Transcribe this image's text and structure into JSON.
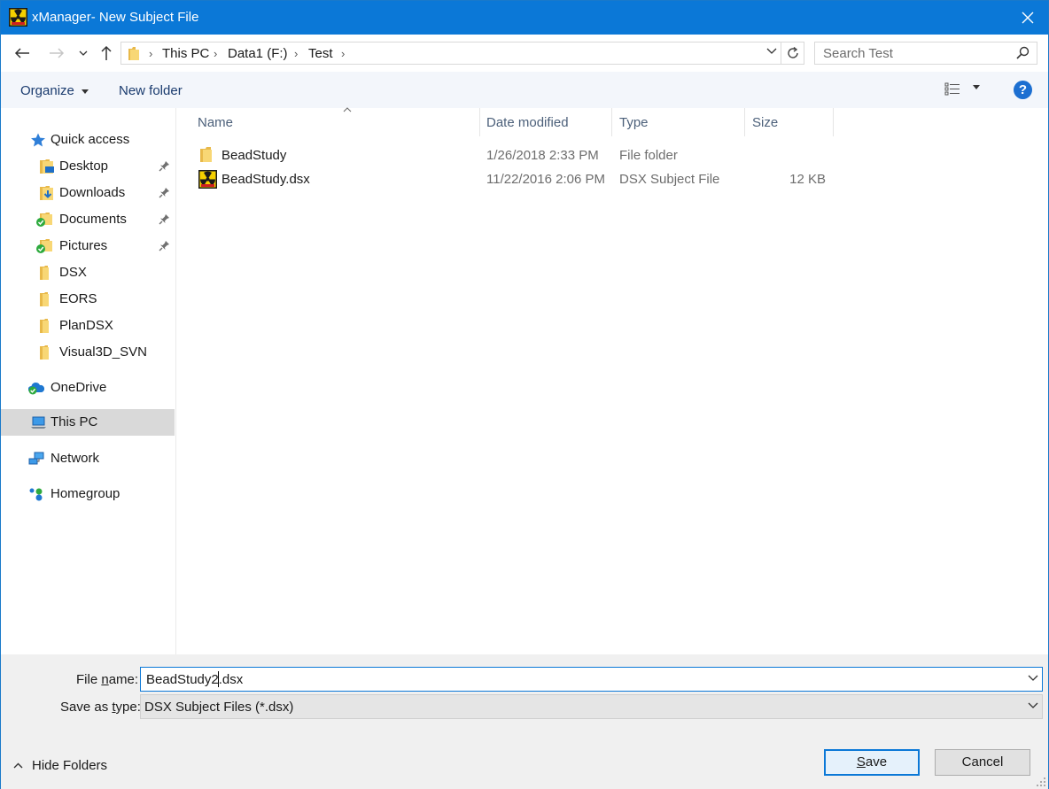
{
  "window": {
    "title": "xManager- New Subject File"
  },
  "address": {
    "crumbs": [
      "This PC",
      "Data1 (F:)",
      "Test"
    ],
    "search_placeholder": "Search Test"
  },
  "toolbar": {
    "organize": "Organize",
    "new_folder": "New folder",
    "help": "?"
  },
  "nav": {
    "quick_access": "Quick access",
    "items": [
      {
        "label": "Desktop",
        "pinned": true
      },
      {
        "label": "Downloads",
        "pinned": true
      },
      {
        "label": "Documents",
        "pinned": true
      },
      {
        "label": "Pictures",
        "pinned": true
      },
      {
        "label": "DSX",
        "pinned": false
      },
      {
        "label": "EORS",
        "pinned": false
      },
      {
        "label": "PlanDSX",
        "pinned": false
      },
      {
        "label": "Visual3D_SVN",
        "pinned": false
      }
    ],
    "onedrive": "OneDrive",
    "this_pc": "This PC",
    "network": "Network",
    "homegroup": "Homegroup"
  },
  "files": {
    "columns": [
      "Name",
      "Date modified",
      "Type",
      "Size"
    ],
    "rows": [
      {
        "name": "BeadStudy",
        "date": "1/26/2018 2:33 PM",
        "type": "File folder",
        "size": ""
      },
      {
        "name": "BeadStudy.dsx",
        "date": "11/22/2016 2:06 PM",
        "type": "DSX Subject File",
        "size": "12 KB"
      }
    ]
  },
  "form": {
    "file_name_label_pre": "File ",
    "file_name_label_u": "n",
    "file_name_label_post": "ame:",
    "file_name_value": "BeadStudy2.dsx",
    "save_type_label_pre": "Save as ",
    "save_type_label_u": "t",
    "save_type_label_post": "ype:",
    "save_type_value": "DSX Subject Files (*.dsx)",
    "hide_folders": "Hide Folders",
    "save_u": "S",
    "save_rest": "ave",
    "cancel": "Cancel"
  }
}
